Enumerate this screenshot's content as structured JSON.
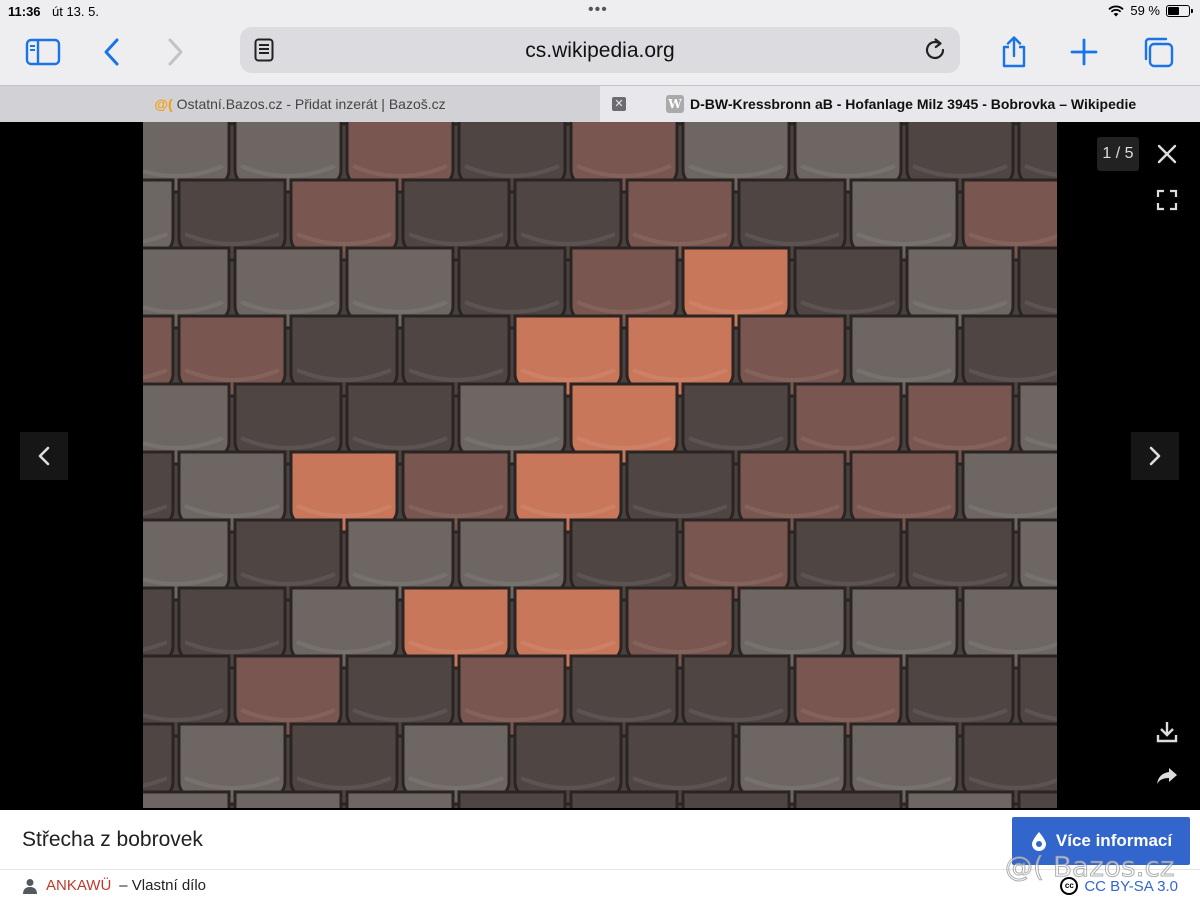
{
  "status_bar": {
    "time": "11:36",
    "date": "út 13. 5.",
    "battery": "59 %",
    "battery_level": 0.59
  },
  "toolbar": {
    "url": "cs.wikipedia.org"
  },
  "tabs": [
    {
      "favicon": "@(",
      "title": "Ostatní.Bazos.cz - Přidat inzerát | Bazoš.cz"
    },
    {
      "favicon": "W",
      "close": "✕",
      "title": "D-BW-Kressbronn aB - Hofanlage Milz 3945 - Bobrovka – Wikipedie"
    }
  ],
  "viewer": {
    "counter": "1 / 5",
    "image_colors": {
      "dark_tile": "#4f4644",
      "grey_tile": "#6d6663",
      "brown_tile": "#7a5650",
      "orange_tile": "#c9775a"
    }
  },
  "caption": {
    "title": "Střecha z bobrovek",
    "more_button": "Více informací",
    "author": "ANKAWÜ",
    "author_suffix": "– Vlastní dílo",
    "license_badge": "cc",
    "license": "CC BY-SA 3.0"
  },
  "watermark": "@( Bazos.cz",
  "colors": {
    "accent": "#3366cc",
    "ios_blue": "#1a73e8",
    "author_link": "#c0392b"
  }
}
